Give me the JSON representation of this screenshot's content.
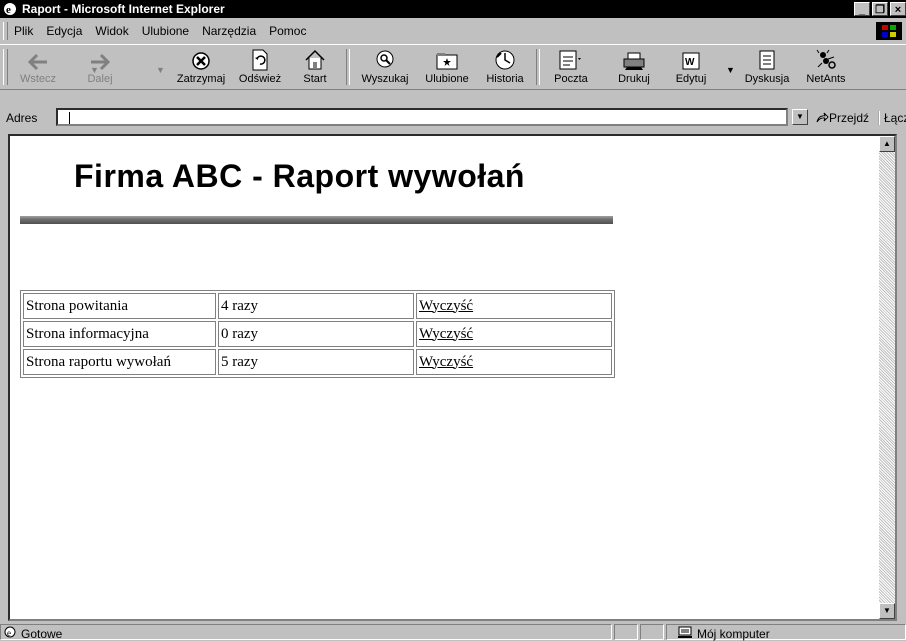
{
  "window": {
    "title": "Raport - Microsoft Internet Explorer"
  },
  "menu": [
    "Plik",
    "Edycja",
    "Widok",
    "Ulubione",
    "Narzędzia",
    "Pomoc"
  ],
  "toolbar": {
    "back": "Wstecz",
    "forward": "Dalej",
    "stop": "Zatrzymaj",
    "refresh": "Odśwież",
    "home": "Start",
    "search": "Wyszukaj",
    "favorites": "Ulubione",
    "history": "Historia",
    "mail": "Poczta",
    "print": "Drukuj",
    "edit": "Edytuj",
    "discuss": "Dyskusja",
    "netants": "NetAnts"
  },
  "address": {
    "label": "Adres",
    "value": "",
    "go": "Przejdź",
    "links": "Łącza"
  },
  "page": {
    "heading": "Firma ABC - Raport wywołań",
    "rows": [
      {
        "name": "Strona powitania",
        "count": "4 razy",
        "action": "Wyczyść"
      },
      {
        "name": "Strona informacyjna",
        "count": "0 razy",
        "action": "Wyczyść"
      },
      {
        "name": "Strona raportu wywołań",
        "count": "5 razy",
        "action": "Wyczyść"
      }
    ]
  },
  "status": {
    "text": "Gotowe",
    "zone": "Mój komputer"
  }
}
